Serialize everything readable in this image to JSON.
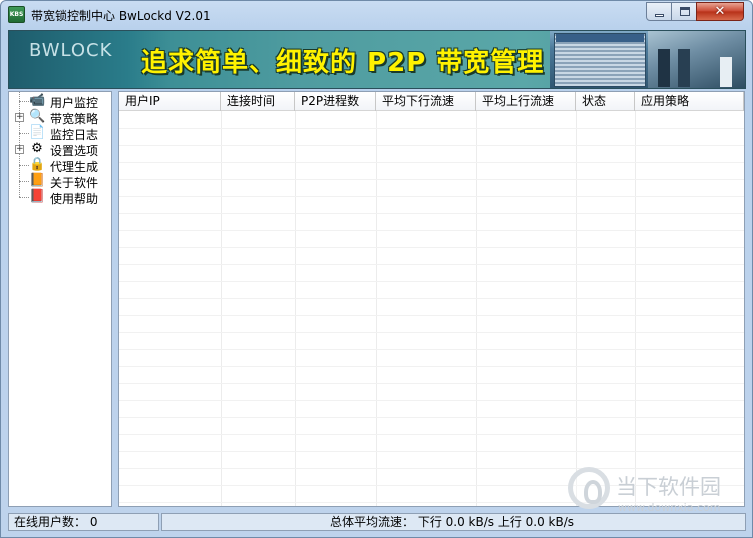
{
  "window": {
    "title": "带宽锁控制中心 BwLockd  V2.01",
    "icon_text": "KBS",
    "controls": {
      "minimize": "minimize",
      "maximize": "maximize",
      "close": "✕"
    }
  },
  "banner": {
    "logo": "BWLOCK",
    "slogan": "追求简单、细致的 P2P 带宽管理"
  },
  "tree": {
    "items": [
      {
        "label": "用户监控",
        "icon": "monitor-icon",
        "expandable": false
      },
      {
        "label": "带宽策略",
        "icon": "policy-icon",
        "expandable": true
      },
      {
        "label": "监控日志",
        "icon": "log-icon",
        "expandable": false
      },
      {
        "label": "设置选项",
        "icon": "settings-icon",
        "expandable": true
      },
      {
        "label": "代理生成",
        "icon": "lock-icon",
        "expandable": false
      },
      {
        "label": "关于软件",
        "icon": "book-icon",
        "expandable": false
      },
      {
        "label": "使用帮助",
        "icon": "help-book-icon",
        "expandable": false
      }
    ]
  },
  "table": {
    "columns": [
      "用户IP",
      "连接时间",
      "P2P进程数",
      "平均下行流速",
      "平均上行流速",
      "状态",
      "应用策略"
    ],
    "rows": []
  },
  "status": {
    "online_users": "在线用户数： 0",
    "avg_flow": "总体平均流速： 下行 0.0 kB/s  上行 0.0 kB/s"
  },
  "watermark": {
    "text": "当下软件园",
    "url": "www.downxia.com"
  }
}
